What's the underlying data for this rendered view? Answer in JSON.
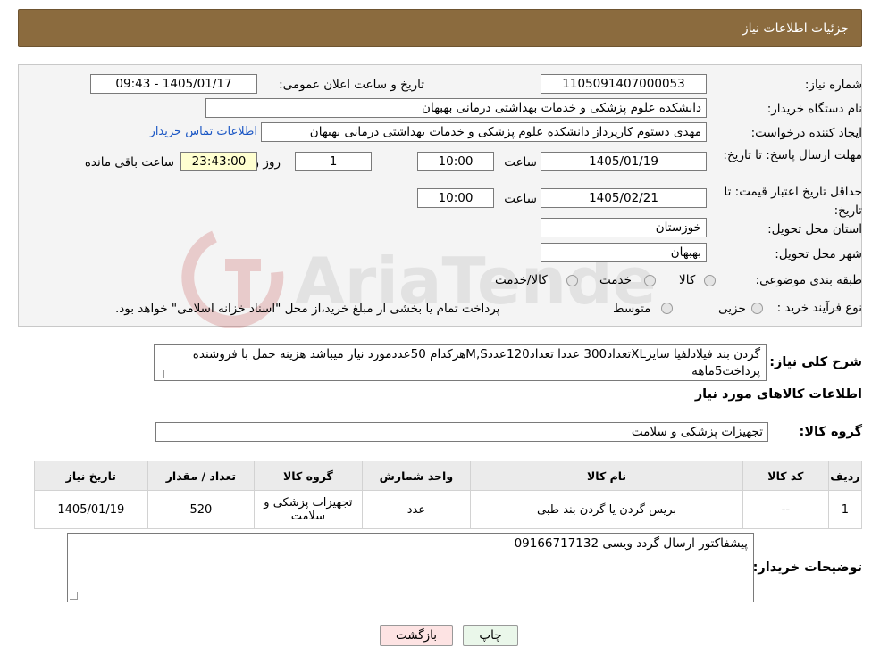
{
  "header": {
    "title": "جزئیات اطلاعات نیاز"
  },
  "fields": {
    "need_number_label": "شماره نیاز:",
    "need_number": "1105091407000053",
    "announce_label": "تاریخ و ساعت اعلان عمومی:",
    "announce_value": "1405/01/17 - 09:43",
    "buyer_org_label": "نام دستگاه خریدار:",
    "buyer_org": "دانشکده علوم پزشکی و خدمات بهداشتی  درمانی بهبهان",
    "requester_label": "ایجاد کننده درخواست:",
    "requester": "مهدی دستوم کارپرداز دانشکده علوم پزشکی و خدمات بهداشتی  درمانی بهبهان",
    "contact_link": "اطلاعات تماس خریدار",
    "deadline_label": "مهلت ارسال پاسخ: تا تاریخ:",
    "deadline_date": "1405/01/19",
    "time_label": "ساعت",
    "deadline_time": "10:00",
    "days_value": "1",
    "days_label": "روز و",
    "remaining_time": "23:43:00",
    "remaining_label": "ساعت باقی مانده",
    "validity_label": "حداقل تاریخ اعتبار قیمت: تا تاریخ:",
    "validity_date": "1405/02/21",
    "validity_time": "10:00",
    "province_label": "استان محل تحویل:",
    "province": "خوزستان",
    "city_label": "شهر محل تحویل:",
    "city": "بهبهان",
    "category_label": "طبقه بندی موضوعی:",
    "category_options": [
      "کالا",
      "خدمت",
      "کالا/خدمت"
    ],
    "process_label": "نوع فرآیند خرید :",
    "process_options": [
      "جزیی",
      "متوسط"
    ],
    "process_note": "پرداخت تمام یا بخشی از مبلغ خرید،از محل \"اسناد خزانه اسلامی\" خواهد بود."
  },
  "description": {
    "label": "شرح کلی نیاز:",
    "text": "گردن بند فیلادلفیا سایزXLتعداد300 عددا تعداد120عددM,Sهرکدام 50عددمورد نیاز میباشد هزینه حمل با فروشنده پرداخت5ماهه"
  },
  "goods": {
    "section_title": "اطلاعات کالاهای مورد نیاز",
    "group_label": "گروه کالا:",
    "group_value": "تجهیزات پزشکی و سلامت"
  },
  "table": {
    "headers": [
      "ردیف",
      "کد کالا",
      "نام کالا",
      "واحد شمارش",
      "گروه کالا",
      "تعداد / مقدار",
      "تاریخ نیاز"
    ],
    "rows": [
      [
        "1",
        "--",
        "بریس گردن یا گردن بند طبی",
        "عدد",
        "تجهیزات پزشکی و سلامت",
        "520",
        "1405/01/19"
      ]
    ]
  },
  "buyer_notes": {
    "label": "توضیحات خریدار:",
    "text": "پیشفاکتور ارسال گردد ویسی 09166717132"
  },
  "buttons": {
    "print": "چاپ",
    "back": "بازگشت"
  },
  "watermark": {
    "text": "AriaTender.neT"
  },
  "colors": {
    "header_bg": "#8b6b3e",
    "link": "#1a56c4",
    "back_button_bg": "#fde3e3",
    "print_button_bg": "#eaf7ea"
  }
}
